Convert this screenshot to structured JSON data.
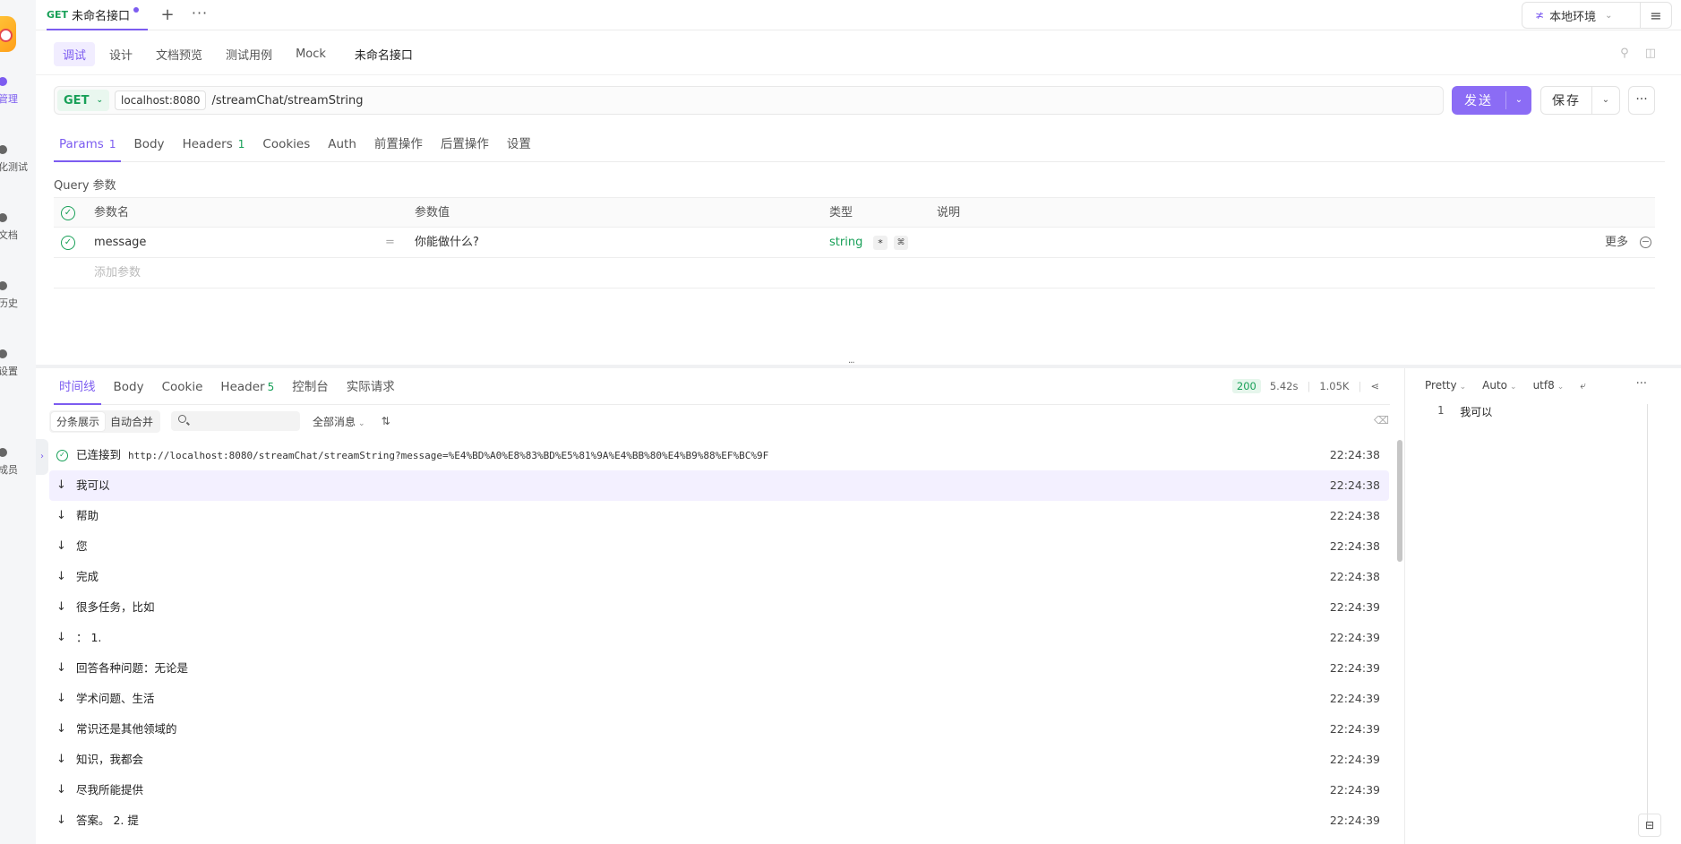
{
  "rail": {
    "items": [
      {
        "label": "管理",
        "icon": "folder-icon",
        "active": true
      },
      {
        "label": "化测试",
        "icon": "test-icon"
      },
      {
        "label": "文档",
        "icon": "doc-icon"
      },
      {
        "label": "历史",
        "icon": "history-icon"
      },
      {
        "label": "设置",
        "icon": "gear-icon"
      },
      {
        "label": "成员",
        "icon": "member-icon"
      }
    ],
    "expand": "›"
  },
  "tabbar": {
    "method": "GET",
    "title": "未命名接口",
    "plus": "+",
    "more": "···",
    "env": "本地环境",
    "env_icon": "≭",
    "menu_icon": "≡"
  },
  "subnav": {
    "tabs": [
      "调试",
      "设计",
      "文档预览",
      "测试用例",
      "Mock"
    ],
    "api_name": "未命名接口"
  },
  "request": {
    "method": "GET",
    "host": "localhost:8080",
    "path": "/streamChat/streamString",
    "send": "发送",
    "save": "保存",
    "more": "···"
  },
  "req_tabs": [
    {
      "label": "Params",
      "count": "1",
      "active": true
    },
    {
      "label": "Body",
      "count": ""
    },
    {
      "label": "Headers",
      "count": "1"
    },
    {
      "label": "Cookies",
      "count": ""
    },
    {
      "label": "Auth",
      "count": ""
    },
    {
      "label": "前置操作",
      "count": ""
    },
    {
      "label": "后置操作",
      "count": ""
    },
    {
      "label": "设置",
      "count": ""
    }
  ],
  "query": {
    "label": "Query 参数",
    "headers": {
      "name": "参数名",
      "value": "参数值",
      "type": "类型",
      "desc": "说明"
    },
    "row": {
      "name": "message",
      "eq": "=",
      "value": "你能做什么?",
      "type": "string",
      "req": "*",
      "more": "更多",
      "minus": "−"
    },
    "add_placeholder": "添加参数"
  },
  "response": {
    "tabs": [
      {
        "label": "时间线",
        "count": "",
        "active": true
      },
      {
        "label": "Body",
        "count": ""
      },
      {
        "label": "Cookie",
        "count": ""
      },
      {
        "label": "Header",
        "count": "5"
      },
      {
        "label": "控制台",
        "count": ""
      },
      {
        "label": "实际请求",
        "count": ""
      }
    ],
    "status": "200",
    "time": "5.42s",
    "size": "1.05K",
    "toolbar": {
      "seg1": "分条展示",
      "seg2": "自动合并",
      "filter": "全部消息",
      "sort_icon": "⇅"
    },
    "connected_label": "已连接到",
    "connected_url": "http://localhost:8080/streamChat/streamString?message=%E4%BD%A0%E8%83%BD%E5%81%9A%E4%BB%80%E4%B9%88%EF%BC%9F",
    "connected_time": "22:24:38",
    "messages": [
      {
        "text": "我可以",
        "time": "22:24:38",
        "hl": true
      },
      {
        "text": "帮助",
        "time": "22:24:38"
      },
      {
        "text": "您",
        "time": "22:24:38"
      },
      {
        "text": "完成",
        "time": "22:24:38"
      },
      {
        "text": "很多任务，比如",
        "time": "22:24:39"
      },
      {
        "text": "： 1.",
        "time": "22:24:39"
      },
      {
        "text": "回答各种问题：无论是",
        "time": "22:24:39"
      },
      {
        "text": "学术问题、生活",
        "time": "22:24:39"
      },
      {
        "text": "常识还是其他领域的",
        "time": "22:24:39"
      },
      {
        "text": "知识，我都会",
        "time": "22:24:39"
      },
      {
        "text": "尽我所能提供",
        "time": "22:24:39"
      },
      {
        "text": "答案。 2. 提",
        "time": "22:24:39"
      }
    ]
  },
  "preview": {
    "format": "Pretty",
    "mode": "Auto",
    "encoding": "utf8",
    "line_no": "1",
    "content": "我可以"
  },
  "colors": {
    "accent": "#7c5cf0",
    "success": "#18a058"
  }
}
